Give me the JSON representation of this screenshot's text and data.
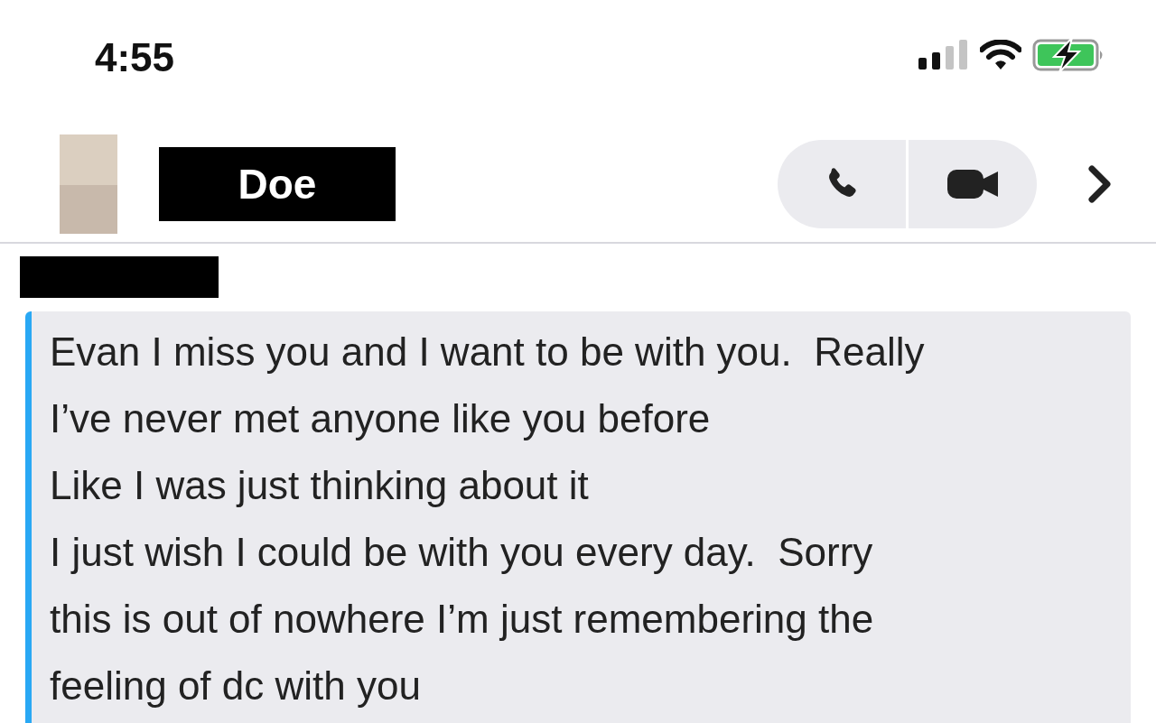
{
  "status_bar": {
    "time": "4:55"
  },
  "header": {
    "name": "Doe"
  },
  "message": {
    "lines": [
      "Evan I miss you and I want to be with you.  Really",
      "I’ve never met anyone like you before",
      "Like I was just thinking about it",
      "I just wish I could be with you every day.  Sorry",
      "this is out of nowhere I’m just remembering the",
      "feeling of dc with you"
    ]
  }
}
